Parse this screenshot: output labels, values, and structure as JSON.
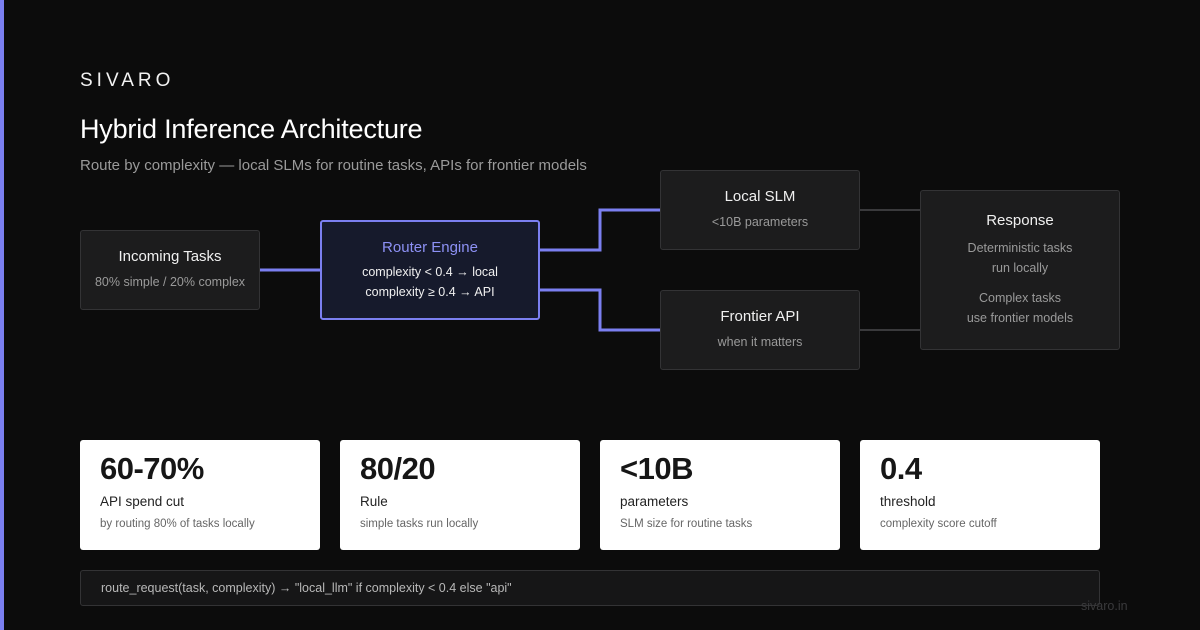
{
  "brand": "SIVARO",
  "title": "Hybrid Inference Architecture",
  "subtitle": "Route by complexity — local SLMs for routine tasks, APIs for frontier models",
  "nodes": {
    "incoming": {
      "title": "Incoming Tasks",
      "line1": "80% simple / 20% complex"
    },
    "router": {
      "title": "Router Engine",
      "line1": "complexity < 0.4 → local",
      "line2": "complexity ≥ 0.4 → API"
    },
    "local": {
      "title": "Local SLM",
      "line1": "<10B parameters"
    },
    "frontier": {
      "title": "Frontier API",
      "line1": "when it matters"
    },
    "response": {
      "title": "Response",
      "line1": "Deterministic tasks",
      "line2": "run locally",
      "line3": "Complex tasks",
      "line4": "use frontier models"
    }
  },
  "stats": [
    {
      "value": "60-70%",
      "label": "API spend cut",
      "desc": "by routing 80% of tasks locally"
    },
    {
      "value": "80/20",
      "label": "Rule",
      "desc": "simple tasks run locally"
    },
    {
      "value": "<10B",
      "label": "parameters",
      "desc": "SLM size for routine tasks"
    },
    {
      "value": "0.4",
      "label": "threshold",
      "desc": "complexity score cutoff"
    }
  ],
  "code": "route_request(task, complexity) → \"local_llm\" if complexity < 0.4 else \"api\"",
  "footer": "sivaro.in",
  "colors": {
    "accent": "#7b7ff0",
    "background": "#0c0c0c",
    "card": "#ffffff",
    "node": "#1c1c1d"
  }
}
